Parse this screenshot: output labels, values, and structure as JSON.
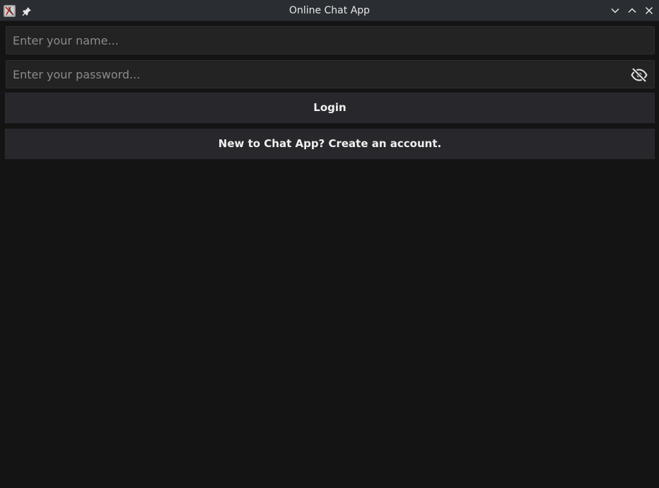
{
  "window": {
    "title": "Online Chat App",
    "icons": {
      "app": "app-icon",
      "pin": "pin-icon",
      "minimize": "chevron-down-icon",
      "maximize": "chevron-up-icon",
      "close": "close-icon"
    }
  },
  "login_form": {
    "name_field": {
      "value": "",
      "placeholder": "Enter your name..."
    },
    "password_field": {
      "value": "",
      "placeholder": "Enter your password...",
      "visibility_icon": "eye-off-icon"
    },
    "login_button_label": "Login",
    "create_account_label": "New to Chat App? Create an account."
  },
  "colors": {
    "background": "#141414",
    "titlebar": "#2a2e32",
    "input_bg": "#232323",
    "button_bg": "#28282c",
    "text": "#f0f0f0",
    "placeholder": "#8b8b8b"
  }
}
